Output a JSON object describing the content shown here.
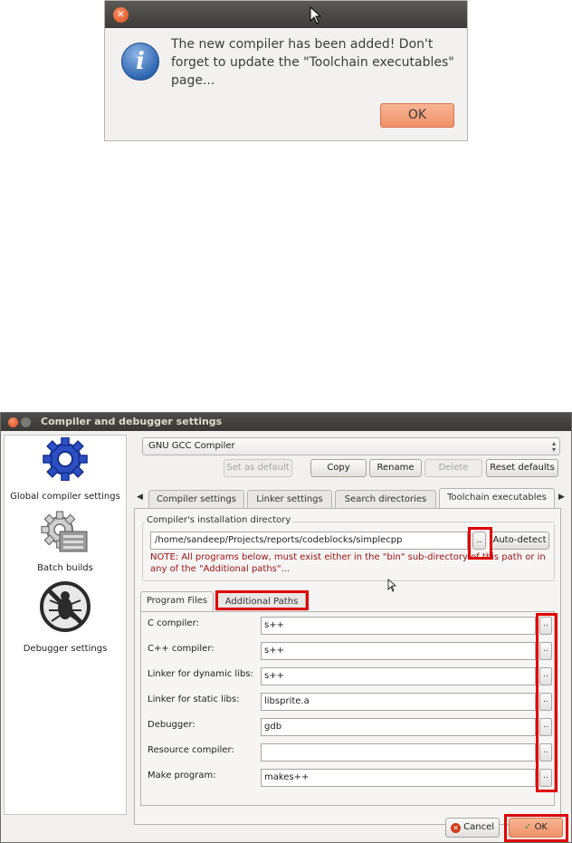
{
  "message_dialog": {
    "text": "The new compiler has been added! Don't forget to update the \"Toolchain executables\" page...",
    "ok_label": "OK"
  },
  "window": {
    "title": "Compiler and debugger settings",
    "compiler_select": "GNU GCC Compiler",
    "buttons": {
      "set_default": "Set as default",
      "copy": "Copy",
      "rename": "Rename",
      "delete": "Delete",
      "reset": "Reset defaults"
    },
    "sidebar": [
      {
        "label": "Global compiler settings",
        "icon": "gear-icon"
      },
      {
        "label": "Batch builds",
        "icon": "gear-batch-icon"
      },
      {
        "label": "Debugger settings",
        "icon": "bug-icon"
      }
    ],
    "tabs": [
      "Compiler settings",
      "Linker settings",
      "Search directories",
      "Toolchain executables"
    ],
    "install_dir": {
      "label": "Compiler's installation directory",
      "path": "/home/sandeep/Projects/reports/codeblocks/simplecpp",
      "browse_label": "..",
      "autodetect_label": "Auto-detect",
      "note": "NOTE: All programs below, must exist either in the \"bin\" sub-directory of this path or in any of the \"Additional paths\"..."
    },
    "subtabs": [
      "Program Files",
      "Additional Paths"
    ],
    "programs": [
      {
        "label": "C compiler:",
        "value": "s++"
      },
      {
        "label": "C++ compiler:",
        "value": "s++"
      },
      {
        "label": "Linker for dynamic libs:",
        "value": "s++"
      },
      {
        "label": "Linker for static libs:",
        "value": "libsprite.a"
      },
      {
        "label": "Debugger:",
        "value": "gdb"
      },
      {
        "label": "Resource compiler:",
        "value": ""
      },
      {
        "label": "Make program:",
        "value": "makes++"
      }
    ],
    "row_button_label": "..",
    "cancel_label": "Cancel",
    "ok_label": "OK"
  },
  "colors": {
    "highlight": "#e00000",
    "note_text": "#9a1212",
    "ok_button": "#ef9169"
  }
}
